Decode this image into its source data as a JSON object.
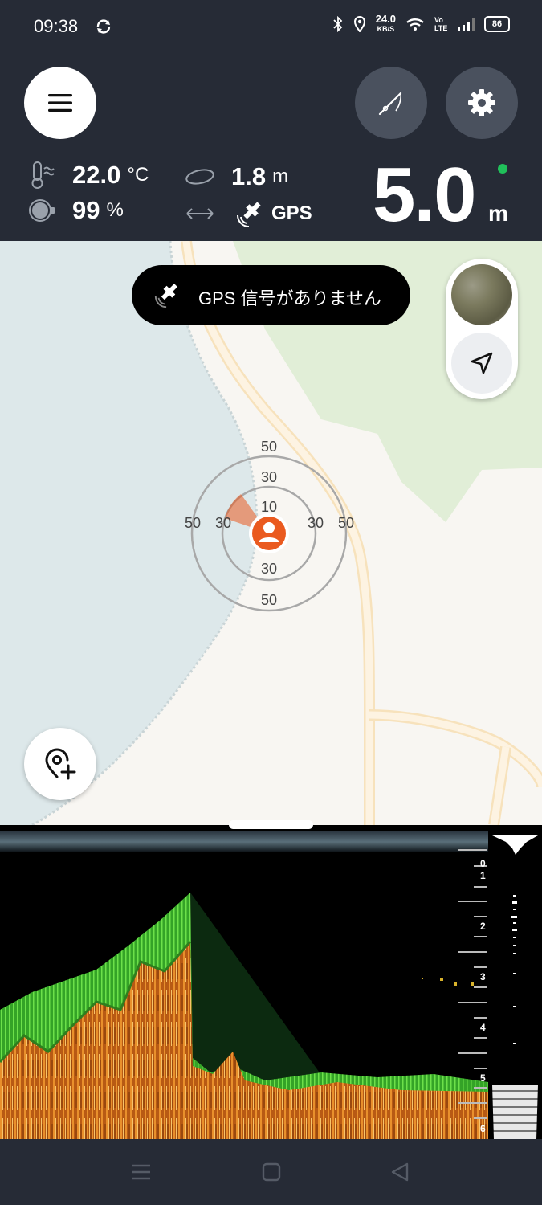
{
  "status_bar": {
    "time": "09:38",
    "net_speed_value": "24.0",
    "net_speed_unit": "KB/S",
    "volte": "Vo LTE",
    "battery": "86"
  },
  "metrics": {
    "water_temp": "22.0",
    "water_temp_unit": "°C",
    "battery_pct": "99",
    "battery_unit": "%",
    "bottom_distance": "1.8",
    "bottom_distance_unit": "m",
    "gps_label": "GPS",
    "depth": "5.0",
    "depth_unit": "m"
  },
  "toast": {
    "message": "GPS 信号がありません"
  },
  "range_rings": {
    "top": [
      "50",
      "30",
      "10"
    ],
    "bottom": [
      "30",
      "50"
    ],
    "left": [
      "50",
      "30"
    ],
    "right": [
      "30",
      "50"
    ]
  },
  "depth_scale": [
    "0",
    "1",
    "2",
    "3",
    "4",
    "5",
    "6"
  ],
  "icons": {
    "menu": "hamburger-icon",
    "rod": "fishing-rod-icon",
    "settings": "gear-icon",
    "locate": "navigation-arrow-icon",
    "add_marker": "add-location-icon",
    "satellite": "satellite-icon"
  },
  "colors": {
    "header_bg": "#262b36",
    "button_dark": "#4a515e",
    "accent_orange": "#ea5a1f",
    "status_online": "#20c05a",
    "water": "#dde8ea",
    "land_green": "#e1eed7"
  }
}
